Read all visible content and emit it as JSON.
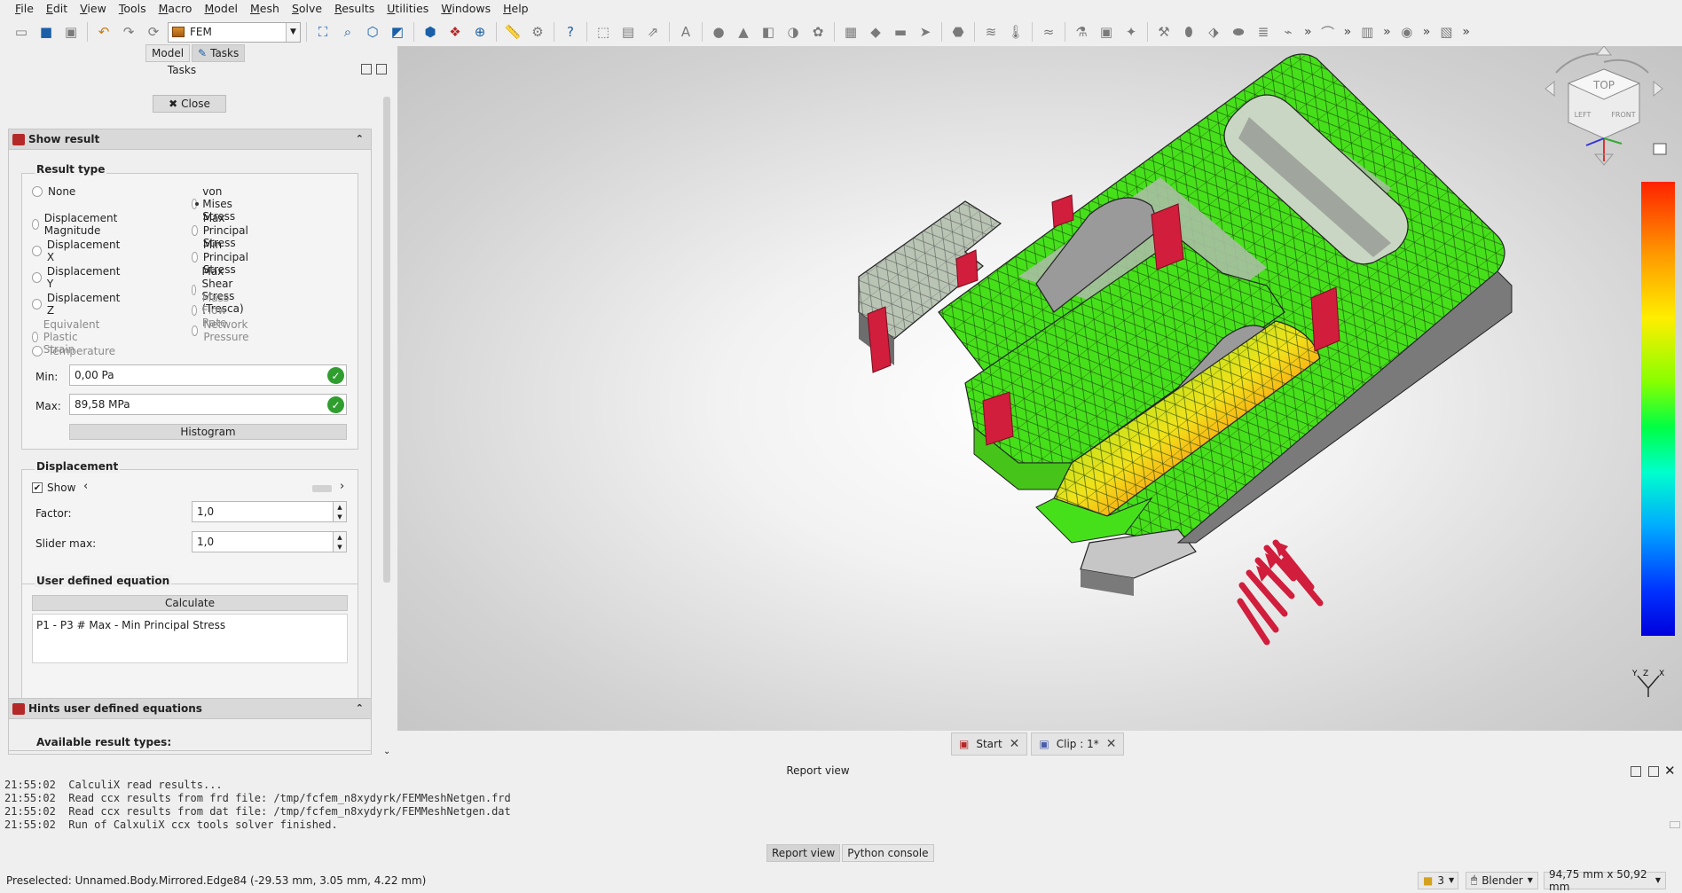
{
  "menu": [
    "File",
    "Edit",
    "View",
    "Tools",
    "Macro",
    "Model",
    "Mesh",
    "Solve",
    "Results",
    "Utilities",
    "Windows",
    "Help"
  ],
  "workbench": "FEM",
  "combo_tabs": [
    "Model",
    "Tasks"
  ],
  "panel": {
    "title": "Tasks",
    "close_label": "Close",
    "show_result": {
      "header": "Show result",
      "result_type_title": "Result type",
      "options_left": [
        "None",
        "Displacement Magnitude",
        "Displacement X",
        "Displacement Y",
        "Displacement Z",
        "Equivalent Plastic Strain",
        "Temperature"
      ],
      "options_right": [
        "von Mises Stress",
        "Max Principal Stress",
        "Min Principal Stress",
        "Max Shear Stress (Tresca)",
        "Mass Flow Rate",
        "Network Pressure"
      ],
      "selected": "von Mises Stress",
      "min_label": "Min:",
      "min_value": "0,00 Pa",
      "max_label": "Max:",
      "max_value": "89,58 MPa",
      "histogram_label": "Histogram"
    },
    "displacement": {
      "title": "Displacement",
      "show_label": "Show",
      "show_checked": true,
      "factor_label": "Factor:",
      "factor_value": "1,0",
      "slider_max_label": "Slider max:",
      "slider_max_value": "1,0"
    },
    "user_equation": {
      "title": "User defined equation",
      "calculate_label": "Calculate",
      "equation": "P1 - P3 # Max - Min Principal Stress"
    },
    "hints": {
      "header": "Hints user defined equations",
      "available_label": "Available result types:"
    }
  },
  "doc_tabs": [
    {
      "label": "Start"
    },
    {
      "label": "Clip : 1*"
    }
  ],
  "report": {
    "title": "Report view",
    "lines": [
      "21:55:02  CalculiX read results...",
      "21:55:02  Read ccx results from frd file: /tmp/fcfem_n8xydyrk/FEMMeshNetgen.frd",
      "21:55:02  Read ccx results from dat file: /tmp/fcfem_n8xydyrk/FEMMeshNetgen.dat",
      "21:55:02  Run of CalxuliX ccx tools solver finished."
    ],
    "tabs": [
      "Report view",
      "Python console"
    ]
  },
  "status": {
    "preselected": "Preselected: Unnamed.Body.Mirrored.Edge84 (-29.53 mm, 3.05 mm, 4.22 mm)",
    "layer_count": "3",
    "nav_style": "Blender",
    "dimensions": "94,75 mm x 50,92 mm"
  },
  "colors": {
    "accent_red": "#b52828",
    "mesh_green": "#46e01a",
    "constraint_red": "#d01e3c"
  },
  "navcube_faces": [
    "TOP",
    "FRONT",
    "LEFT"
  ]
}
